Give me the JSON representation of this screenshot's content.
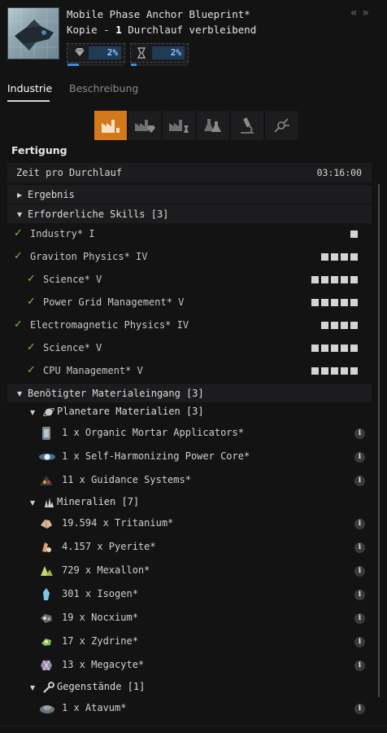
{
  "header": {
    "title": "Mobile Phase Anchor Blueprint*",
    "copy_prefix": "Kopie -",
    "runs": "1",
    "runs_suffix": "Durchlauf verbleibend",
    "material_efficiency": {
      "icon": "gem-icon",
      "value": "2%",
      "progress": 0.2
    },
    "time_efficiency": {
      "icon": "hourglass-icon",
      "value": "2%",
      "progress": 0.1
    },
    "nav": {
      "back": "«",
      "forward": "»"
    }
  },
  "tabs": [
    {
      "label": "Industrie",
      "active": true
    },
    {
      "label": "Beschreibung",
      "active": false
    }
  ],
  "activities": [
    {
      "name": "manufacturing",
      "active": true
    },
    {
      "name": "material-research",
      "active": false
    },
    {
      "name": "time-research",
      "active": false
    },
    {
      "name": "copying",
      "active": false
    },
    {
      "name": "invention",
      "active": false
    },
    {
      "name": "reactions",
      "active": false
    }
  ],
  "section": {
    "title": "Fertigung",
    "time_label": "Zeit pro Durchlauf",
    "time_value": "03:16:00"
  },
  "groups": {
    "ergebnis": "Ergebnis",
    "skills": "Erforderliche Skills [3]",
    "materials": "Benötigter Materialeingang [3]"
  },
  "skills": [
    {
      "name": "Industry* I",
      "level": 1,
      "indent": 0
    },
    {
      "name": "Graviton Physics* IV",
      "level": 4,
      "indent": 0
    },
    {
      "name": "Science* V",
      "level": 5,
      "indent": 1
    },
    {
      "name": "Power Grid Management* V",
      "level": 5,
      "indent": 1
    },
    {
      "name": "Electromagnetic Physics* IV",
      "level": 4,
      "indent": 0
    },
    {
      "name": "Science* V",
      "level": 5,
      "indent": 1
    },
    {
      "name": "CPU Management* V",
      "level": 5,
      "indent": 1
    }
  ],
  "material_groups": [
    {
      "label": "Planetare Materialien [3]",
      "icon": "planet-icon",
      "items": [
        {
          "text": "1 x Organic Mortar Applicators*",
          "icon": "canister-icon"
        },
        {
          "text": "1 x Self-Harmonizing Power Core*",
          "icon": "power-core-icon"
        },
        {
          "text": "11 x Guidance Systems*",
          "icon": "guidance-systems-icon"
        }
      ]
    },
    {
      "label": "Mineralien [7]",
      "icon": "crystal-icon",
      "items": [
        {
          "text": "19.594 x Tritanium*",
          "icon": "tritanium-icon"
        },
        {
          "text": "4.157 x Pyerite*",
          "icon": "pyerite-icon"
        },
        {
          "text": "729 x Mexallon*",
          "icon": "mexallon-icon"
        },
        {
          "text": "301 x Isogen*",
          "icon": "isogen-icon"
        },
        {
          "text": "19 x Nocxium*",
          "icon": "nocxium-icon"
        },
        {
          "text": "17 x Zydrine*",
          "icon": "zydrine-icon"
        },
        {
          "text": "13 x Megacyte*",
          "icon": "megacyte-icon"
        }
      ]
    },
    {
      "label": "Gegenstände [1]",
      "icon": "wrench-icon",
      "items": [
        {
          "text": "1 x Atavum*",
          "icon": "atavum-icon"
        }
      ]
    }
  ],
  "info_glyph": "i",
  "check_glyph": "✓"
}
